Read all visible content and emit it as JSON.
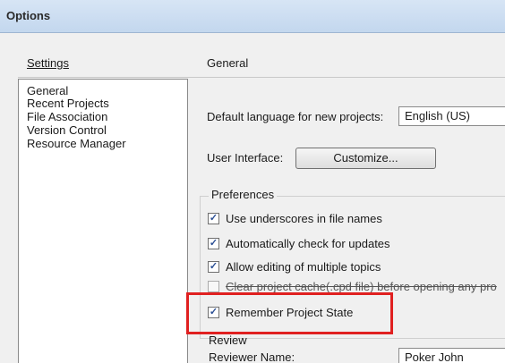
{
  "window": {
    "title": "Options"
  },
  "left_pane": {
    "header": "Settings",
    "items": [
      {
        "label": "General"
      },
      {
        "label": "Recent Projects"
      },
      {
        "label": "File Association"
      },
      {
        "label": "Version Control"
      },
      {
        "label": "Resource Manager"
      }
    ]
  },
  "right_pane": {
    "header": "General",
    "language": {
      "label": "Default language for new projects:",
      "value": "English (US)"
    },
    "ui": {
      "label": "User Interface:",
      "button": "Customize..."
    },
    "preferences": {
      "title": "Preferences",
      "options": [
        {
          "label": "Use underscores in file names",
          "checked": true
        },
        {
          "label": "Automatically check for updates",
          "checked": true
        },
        {
          "label": "Allow editing of multiple topics",
          "checked": true
        },
        {
          "label": "Clear project cache(.cpd file) before opening any pro",
          "checked": false
        },
        {
          "label": "Remember Project State",
          "checked": true
        }
      ]
    },
    "review": {
      "title": "Review",
      "reviewer_label": "Reviewer Name:",
      "reviewer_value": "Poker John"
    }
  },
  "colors": {
    "highlight": "#e02020",
    "checkmark": "#2b4f95"
  },
  "icons": {
    "check": "checkmark-icon"
  }
}
